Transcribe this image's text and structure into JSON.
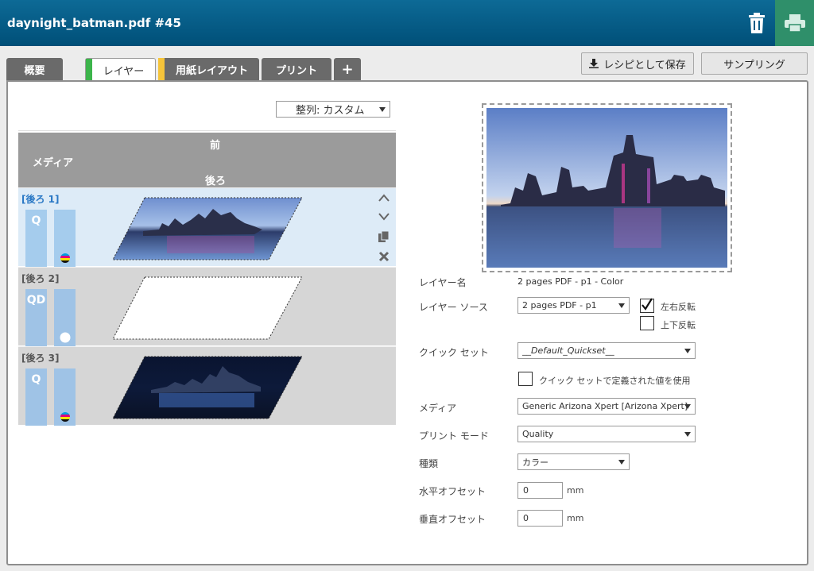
{
  "header": {
    "title": "daynight_batman.pdf #45",
    "delete_icon": "trash-icon",
    "print_icon": "printer-icon",
    "accent": "#2f8f6a"
  },
  "tabs": [
    {
      "label": "概要"
    },
    {
      "label": "レイヤー",
      "marker_color": "#3cb44b"
    },
    {
      "label": "用紙レイアウト",
      "marker_color": "#f5c43a"
    },
    {
      "label": "プリント"
    },
    {
      "label": "+"
    }
  ],
  "toolbar": {
    "save_recipe_label": "レシピとして保存",
    "sampling_label": "サンプリング"
  },
  "sort": {
    "value": "整列: カスタム"
  },
  "layers_header": {
    "front": "前",
    "media": "メディア",
    "back": "後ろ"
  },
  "layers": [
    {
      "name": "[後ろ 1]",
      "mode": "Q",
      "ink": "cmyk",
      "thumb": "city-day"
    },
    {
      "name": "[後ろ 2]",
      "mode": "QD",
      "ink": "white",
      "thumb": "blank"
    },
    {
      "name": "[後ろ 3]",
      "mode": "Q",
      "ink": "cmyk",
      "thumb": "city-night"
    }
  ],
  "row_icons": [
    "chevron-up-icon",
    "chevron-down-icon",
    "copy-icon",
    "close-icon"
  ],
  "form": {
    "layer_name_label": "レイヤー名",
    "layer_name_value": "2 pages PDF - p1 - Color",
    "layer_source_label": "レイヤー ソース",
    "layer_source_value": "2 pages PDF - p1",
    "flip_h_label": "左右反転",
    "flip_h_checked": true,
    "flip_v_label": "上下反転",
    "flip_v_checked": false,
    "quickset_label": "クイック セット",
    "quickset_value": "__Default_Quickset__",
    "use_quickset_label": "クイック セットで定義された値を使用",
    "media_label": "メディア",
    "media_value": "Generic Arizona Xpert [Arizona Xpert]",
    "print_mode_label": "プリント モード",
    "print_mode_value": "Quality",
    "type_label": "種類",
    "type_value": "カラー",
    "h_offset_label": "水平オフセット",
    "h_offset_value": "0",
    "v_offset_label": "垂直オフセット",
    "v_offset_value": "0",
    "unit": "mm"
  }
}
